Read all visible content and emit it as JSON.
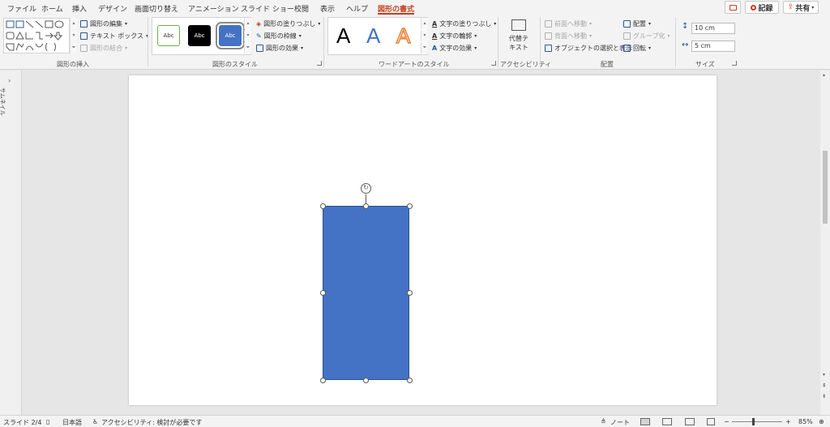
{
  "tabs": [
    "ファイル",
    "ホーム",
    "挿入",
    "デザイン",
    "画面切り替え",
    "アニメーション",
    "スライド ショー",
    "校閲",
    "表示",
    "ヘルプ",
    "図形の書式"
  ],
  "active_tab": "図形の書式",
  "topbar": {
    "record_label": "記録",
    "share_label": "共有"
  },
  "ribbon": {
    "insert_shapes": {
      "label": "図形の挿入",
      "edit_shape": "図形の編集",
      "text_box": "テキスト ボックス",
      "merge_shapes": "図形の結合"
    },
    "shape_styles": {
      "label": "図形のスタイル",
      "presets": [
        "Abc",
        "Abc",
        "Abc"
      ],
      "fill": "図形の塗りつぶし",
      "outline": "図形の枠線",
      "effects": "図形の効果"
    },
    "wordart": {
      "label": "ワードアートのスタイル",
      "sample": "A",
      "text_fill": "文字の塗りつぶし",
      "text_outline": "文字の輪郭",
      "text_effects": "文字の効果"
    },
    "accessibility": {
      "label": "アクセシビリティ",
      "alt_text_line1": "代替テ",
      "alt_text_line2": "キスト"
    },
    "arrange": {
      "label": "配置",
      "bring_forward": "前面へ移動",
      "send_backward": "背面へ移動",
      "selection_pane": "オブジェクトの選択と表示",
      "align": "配置",
      "group": "グループ化",
      "rotate": "回転"
    },
    "size": {
      "label": "サイズ",
      "height": "10 cm",
      "width": "5 cm"
    }
  },
  "left_pane": {
    "label": "サムネイル"
  },
  "status": {
    "slide": "スライド 2/4",
    "language": "日本語",
    "accessibility": "アクセシビリティ: 検討が必要です",
    "notes": "ノート",
    "zoom": "85%",
    "zoom_level": 0.85
  },
  "colors": {
    "accent": "#c43e1c",
    "shape_fill": "#4472c4",
    "wordart_blue": "#4472c4",
    "wordart_orange": "#ed7d31"
  }
}
